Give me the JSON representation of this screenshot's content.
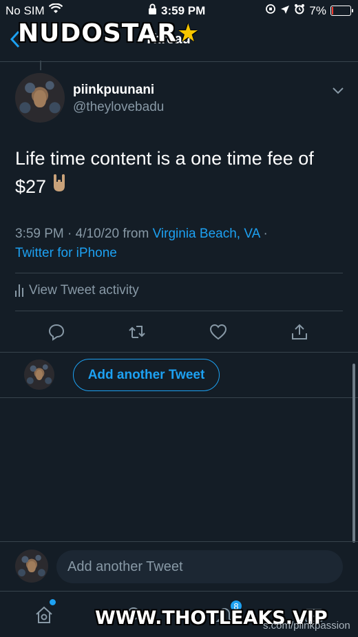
{
  "status_bar": {
    "carrier": "No SIM",
    "time": "3:59 PM",
    "battery": "7%"
  },
  "nav": {
    "title": "Thread"
  },
  "watermarks": {
    "top": "NUDOSTAR",
    "bottom": "WWW.THOTLEAKS.VIP",
    "site": "s.com/piinkpassion"
  },
  "tweet": {
    "display_name": "piinkpuunani",
    "handle": "@theylovebadu",
    "text_line1": "Life time content is a one time fee of",
    "text_line2": "$27",
    "time": "3:59 PM · 4/10/20 from ",
    "location": "Virginia Beach, VA",
    "separator": " ·",
    "client": "Twitter for iPhone",
    "activity_label": "View Tweet activity"
  },
  "reply": {
    "button_label": "Add another Tweet"
  },
  "composer": {
    "placeholder": "Add another Tweet"
  },
  "tabbar": {
    "notification_count": "8"
  },
  "colors": {
    "background": "#141d26",
    "accent": "#1da1f2",
    "secondary_text": "#8899a6",
    "divider": "#38444d"
  }
}
